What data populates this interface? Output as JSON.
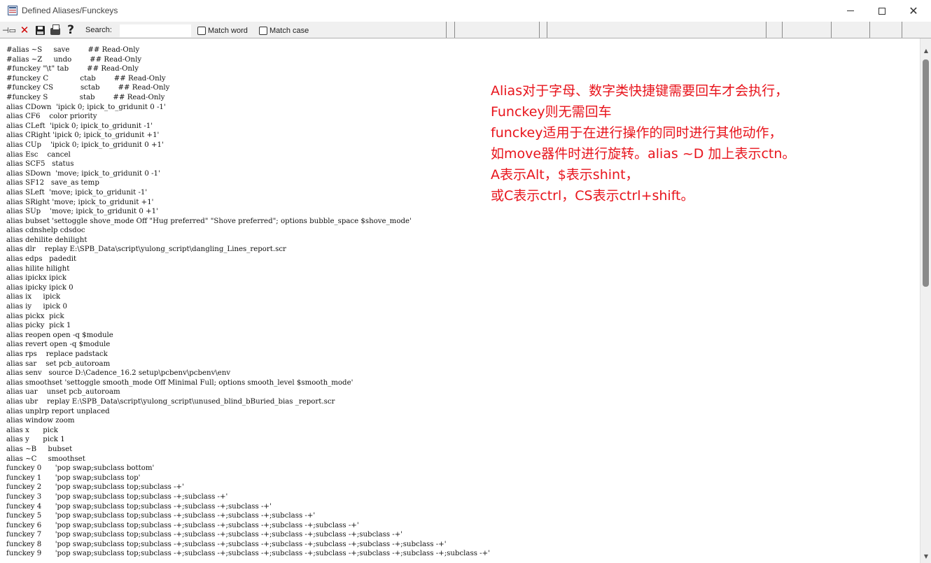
{
  "window": {
    "title": "Defined Aliases/Funckeys",
    "close_glyph": "✕"
  },
  "toolbar": {
    "pin_icon": "pin-icon",
    "delete_glyph": "✕",
    "help_glyph": "?",
    "search_label": "Search:",
    "search_value": "",
    "match_word_label": "Match word",
    "match_case_label": "Match case"
  },
  "lines": [
    "#alias ~S     save        ## Read-Only",
    "#alias ~Z     undo        ## Read-Only",
    "#funckey \"\\t\" tab        ## Read-Only",
    "#funckey C              ctab        ## Read-Only",
    "#funckey CS            sctab        ## Read-Only",
    "#funckey S              stab        ## Read-Only",
    "alias CDown  'ipick 0; ipick_to_gridunit 0 -1'",
    "alias CF6    color priority",
    "alias CLeft  'ipick 0; ipick_to_gridunit -1'",
    "alias CRight 'ipick 0; ipick_to_gridunit +1'",
    "alias CUp    'ipick 0; ipick_to_gridunit 0 +1'",
    "alias Esc    cancel",
    "alias SCF5   status",
    "alias SDown  'move; ipick_to_gridunit 0 -1'",
    "alias SF12   save_as temp",
    "alias SLeft  'move; ipick_to_gridunit -1'",
    "alias SRight 'move; ipick_to_gridunit +1'",
    "alias SUp    'move; ipick_to_gridunit 0 +1'",
    "alias bubset 'settoggle shove_mode Off \"Hug preferred\" \"Shove preferred\"; options bubble_space $shove_mode'",
    "alias cdnshelp cdsdoc",
    "alias dehilite dehilight",
    "alias dlr    replay E:\\SPB_Data\\script\\yulong_script\\dangling_Lines_report.scr",
    "alias edps   padedit",
    "alias hilite hilight",
    "alias ipickx ipick",
    "alias ipicky ipick 0",
    "alias ix     ipick",
    "alias iy     ipick 0",
    "alias pickx  pick",
    "alias picky  pick 1",
    "alias reopen open -q $module",
    "alias revert open -q $module",
    "alias rps    replace padstack",
    "alias sar    set pcb_autoroam",
    "alias senv   source D:\\Cadence_16.2 setup\\pcbenv\\pcbenv\\env",
    "alias smoothset 'settoggle smooth_mode Off Minimal Full; options smooth_level $smooth_mode'",
    "alias uar    unset pcb_autoroam",
    "alias ubr    replay E:\\SPB_Data\\script\\yulong_script\\unused_blind_bBuried_bias _report.scr",
    "alias unplrp report unplaced",
    "alias window zoom",
    "alias x      pick",
    "alias y      pick 1",
    "alias ~B     bubset",
    "alias ~C     smoothset",
    "funckey 0      'pop swap;subclass bottom'",
    "funckey 1      'pop swap;subclass top'",
    "funckey 2      'pop swap;subclass top;subclass -+'",
    "funckey 3      'pop swap;subclass top;subclass -+;subclass -+'",
    "funckey 4      'pop swap;subclass top;subclass -+;subclass -+;subclass -+'",
    "funckey 5      'pop swap;subclass top;subclass -+;subclass -+;subclass -+;subclass -+'",
    "funckey 6      'pop swap;subclass top;subclass -+;subclass -+;subclass -+;subclass -+;subclass -+'",
    "funckey 7      'pop swap;subclass top;subclass -+;subclass -+;subclass -+;subclass -+;subclass -+;subclass -+'",
    "funckey 8      'pop swap;subclass top;subclass -+;subclass -+;subclass -+;subclass -+;subclass -+;subclass -+;subclass -+'",
    "funckey 9      'pop swap;subclass top;subclass -+;subclass -+;subclass -+;subclass -+;subclass -+;subclass -+;subclass -+;subclass -+'"
  ],
  "annotation": [
    "Alias对于字母、数字类快捷键需要回车才会执行，",
    "Funckey则无需回车",
    "funckey适用于在进行操作的同时进行其他动作，",
    "如move器件时进行旋转。alias ~D 加上表示ctn。",
    "A表示Alt，$表示shint，",
    "或C表示ctrl，CS表示ctrl+shift。"
  ],
  "colors": {
    "annotation": "#e8141c",
    "toolbar_bg": "#f0f0f0",
    "delete_icon": "#d00000"
  }
}
